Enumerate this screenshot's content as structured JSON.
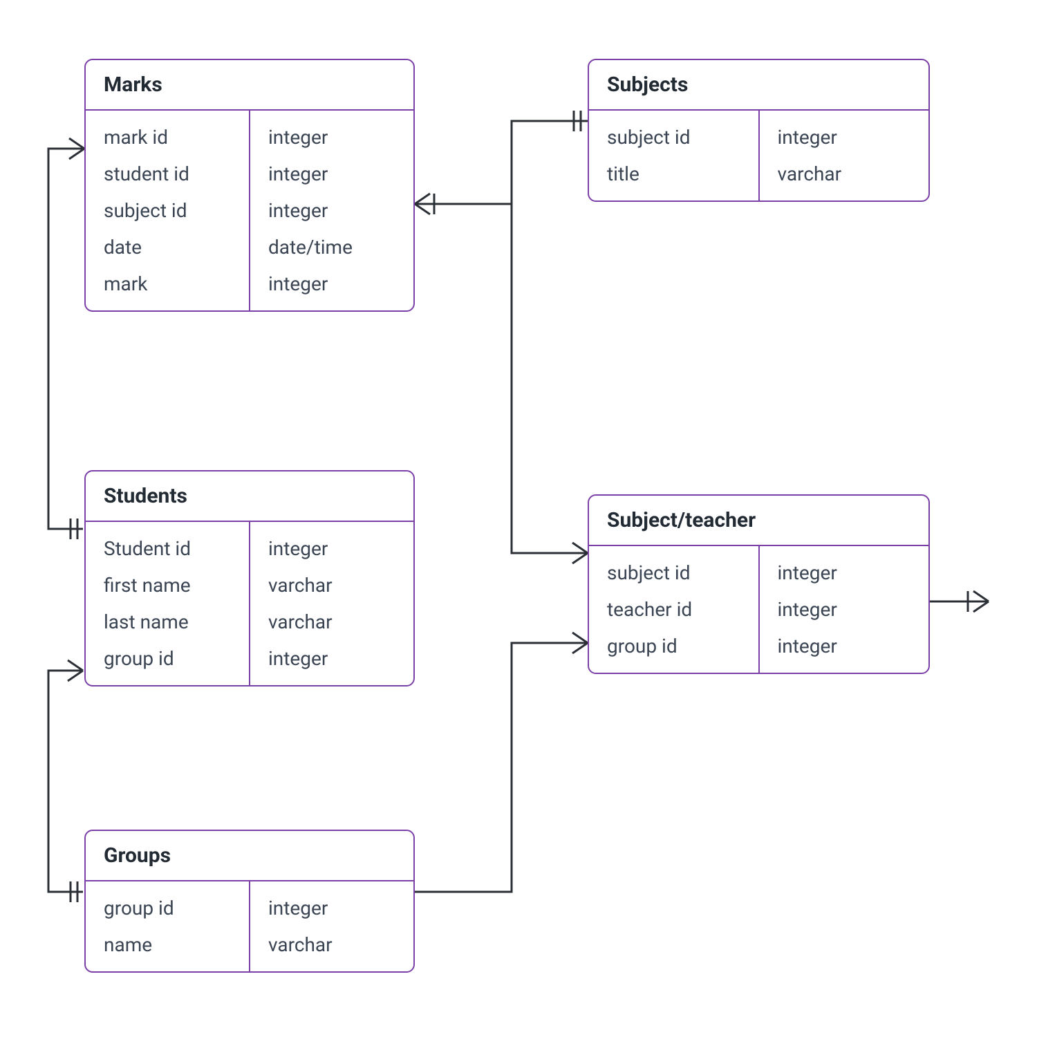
{
  "entities": {
    "marks": {
      "title": "Marks",
      "fields": [
        {
          "name": "mark id",
          "type": "integer"
        },
        {
          "name": "student id",
          "type": "integer"
        },
        {
          "name": "subject id",
          "type": "integer"
        },
        {
          "name": "date",
          "type": "date/time"
        },
        {
          "name": "mark",
          "type": "integer"
        }
      ]
    },
    "subjects": {
      "title": "Subjects",
      "fields": [
        {
          "name": "subject id",
          "type": "integer"
        },
        {
          "name": "title",
          "type": "varchar"
        }
      ]
    },
    "students": {
      "title": "Students",
      "fields": [
        {
          "name": "Student id",
          "type": "integer"
        },
        {
          "name": "first name",
          "type": "varchar"
        },
        {
          "name": "last name",
          "type": "varchar"
        },
        {
          "name": "group id",
          "type": "integer"
        }
      ]
    },
    "subject_teacher": {
      "title": "Subject/teacher",
      "fields": [
        {
          "name": "subject id",
          "type": "integer"
        },
        {
          "name": "teacher id",
          "type": "integer"
        },
        {
          "name": "group id",
          "type": "integer"
        }
      ]
    },
    "groups": {
      "title": "Groups",
      "fields": [
        {
          "name": "group id",
          "type": "integer"
        },
        {
          "name": "name",
          "type": "varchar"
        }
      ]
    }
  },
  "relationships": [
    {
      "from": "marks",
      "to": "students",
      "from_card": "many",
      "to_card": "one"
    },
    {
      "from": "marks",
      "to": "subjects",
      "from_card": "many",
      "to_card": "one"
    },
    {
      "from": "subject_teacher",
      "to": "subjects",
      "from_card": "many",
      "to_card": "one"
    },
    {
      "from": "subject_teacher",
      "to": "groups",
      "from_card": "many",
      "to_card": "one"
    },
    {
      "from": "subject_teacher",
      "to": "teachers_external",
      "from_card": "many",
      "to_card": "one"
    },
    {
      "from": "students",
      "to": "groups",
      "from_card": "many",
      "to_card": "one"
    }
  ]
}
